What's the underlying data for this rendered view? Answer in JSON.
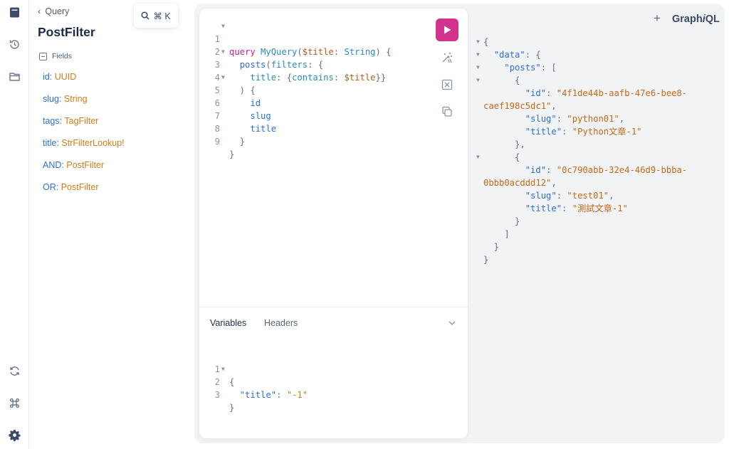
{
  "sidebar": {
    "icons": [
      "docs-icon",
      "history-icon",
      "explorer-icon",
      "refetch-schema-icon",
      "shortcuts-icon",
      "settings-icon"
    ]
  },
  "docs": {
    "back_label": "Query",
    "title": "PostFilter",
    "fields_heading": "Fields",
    "fields": [
      {
        "name": "id",
        "type": "UUID"
      },
      {
        "name": "slug",
        "type": "String"
      },
      {
        "name": "tags",
        "type": "TagFilter"
      },
      {
        "name": "title",
        "type": "StrFilterLookup!"
      },
      {
        "name": "AND",
        "type": "PostFilter"
      },
      {
        "name": "OR",
        "type": "PostFilter"
      }
    ]
  },
  "search": {
    "shortcut": "⌘ K"
  },
  "query_editor": {
    "line_numbers": [
      "1",
      "2",
      "3",
      "4",
      "5",
      "6",
      "7",
      "8",
      "9"
    ],
    "keyword": "query",
    "operation_name": "MyQuery",
    "variable_name": "$title",
    "variable_type": "String",
    "field_posts": "posts",
    "arg_filters": "filters",
    "filter_title": "title",
    "filter_contains": "contains",
    "selection_fields": [
      "id",
      "slug",
      "title"
    ]
  },
  "variables_panel": {
    "tabs": [
      "Variables",
      "Headers"
    ],
    "line_numbers": [
      "1",
      "2",
      "3"
    ],
    "key": "\"title\"",
    "value": "\"-1\""
  },
  "header": {
    "logo_prefix": "Graph",
    "logo_italic": "i",
    "logo_suffix": "QL"
  },
  "response": {
    "data_key": "\"data\"",
    "posts_key": "\"posts\"",
    "items": [
      {
        "id_line1": "\"4f1de44b-aafb-47e6-bee8-",
        "id_line2": "caef198c5dc1\"",
        "slug": "\"python01\"",
        "title": "\"Python文章-1\""
      },
      {
        "id_line1": "\"0c790abb-32e4-46d9-bbba-",
        "id_line2": "0bbb0acddd12\"",
        "slug": "\"test01\"",
        "title": "\"測試文章-1\""
      }
    ],
    "keys": {
      "id": "\"id\"",
      "slug": "\"slug\"",
      "title": "\"title\""
    }
  },
  "colors": {
    "accent": "#d1338e",
    "field_name": "#2b6fd6",
    "field_type": "#d07d18"
  }
}
